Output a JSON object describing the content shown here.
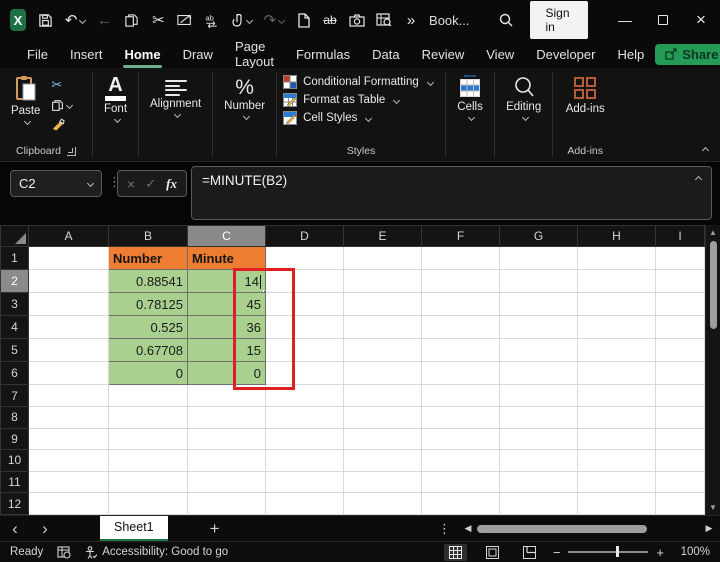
{
  "titlebar": {
    "title": "Book...",
    "sign_in": "Sign in",
    "overflow": "»",
    "qat_icons": [
      "excel-logo",
      "save",
      "undo",
      "back",
      "copy",
      "cut",
      "picture-pen",
      "replace",
      "touch-mode",
      "redo",
      "new-file",
      "strikethrough",
      "camera",
      "inspect-workbook",
      "search"
    ]
  },
  "menu": {
    "items": [
      "File",
      "Insert",
      "Home",
      "Draw",
      "Page Layout",
      "Formulas",
      "Data",
      "Review",
      "View",
      "Developer",
      "Help"
    ],
    "active": "Home",
    "share": "Share"
  },
  "ribbon": {
    "paste": "Paste",
    "font": "Font",
    "alignment": "Alignment",
    "number": "Number",
    "conditional_formatting": "Conditional Formatting",
    "format_as_table": "Format as Table",
    "cell_styles": "Cell Styles",
    "cells": "Cells",
    "editing": "Editing",
    "addins_button": "Add-ins",
    "group_clipboard": "Clipboard",
    "group_styles": "Styles",
    "group_addins": "Add-ins"
  },
  "formula_bar": {
    "name_box": "C2",
    "fx": "fx",
    "formula": "=MINUTE(B2)"
  },
  "grid": {
    "column_headers": [
      "A",
      "B",
      "C",
      "D",
      "E",
      "F",
      "G",
      "H",
      "I"
    ],
    "row_headers": [
      "1",
      "2",
      "3",
      "4",
      "5",
      "6",
      "7",
      "8",
      "9",
      "10",
      "11",
      "12"
    ],
    "selected_column": "C",
    "selected_row": "2",
    "active_cell": "C2",
    "table": {
      "header_number": "Number",
      "header_minute": "Minute",
      "rows": [
        {
          "number": "0.88541",
          "minute": "14"
        },
        {
          "number": "0.78125",
          "minute": "45"
        },
        {
          "number": "0.525",
          "minute": "36"
        },
        {
          "number": "0.67708",
          "minute": "15"
        },
        {
          "number": "0",
          "minute": "0"
        }
      ]
    }
  },
  "sheet_bar": {
    "tab": "Sheet1",
    "new_sheet": "+"
  },
  "status_bar": {
    "mode": "Ready",
    "accessibility": "Accessibility: Good to go",
    "zoom": "100%"
  },
  "colors": {
    "accent_green": "#259b58",
    "tab_underline_green": "#1e7145",
    "header_fill_orange": "#ED7D31",
    "data_fill_green": "#A9D08E",
    "highlight_box_red": "#E02020",
    "selected_header_gray": "#8a8a8a",
    "addins_icon_rust": "#b85c38"
  }
}
